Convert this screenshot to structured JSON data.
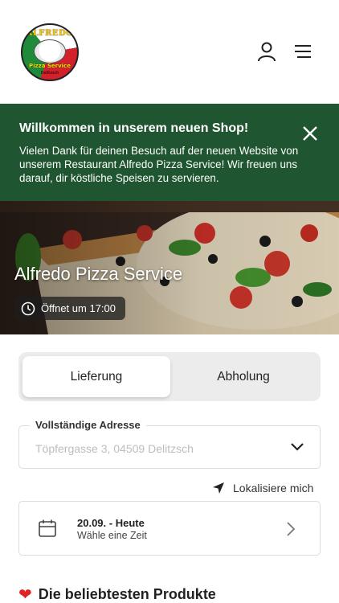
{
  "header": {
    "logo": {
      "top_text": "ALFREDO",
      "bottom_text": "Pizza Service",
      "small_text": "Delitzsch"
    },
    "icons": [
      "user-icon",
      "menu-icon"
    ]
  },
  "banner": {
    "title": "Willkommen in unserem neuen Shop!",
    "text": "Vielen Dank für deinen Besuch auf der neuen Website von unserem Restaurant Alfredo Pizza Service! Wir freuen uns darauf, dir köstliche Speisen zu servieren.",
    "color": "#1f5530"
  },
  "hero": {
    "title": "Alfredo Pizza Service",
    "opening": "Öffnet um 17:00"
  },
  "order_mode": {
    "options": [
      "Lieferung",
      "Abholung"
    ],
    "selected": "Lieferung"
  },
  "address": {
    "label": "Vollständige Adresse",
    "value": "Töpfergasse 3, 04509 Delitzsch"
  },
  "locate": {
    "label": "Lokalisiere mich"
  },
  "time": {
    "date": "20.09. - Heute",
    "sub": "Wähle eine Zeit"
  },
  "popular": {
    "title": "Die beliebtesten Produkte"
  }
}
